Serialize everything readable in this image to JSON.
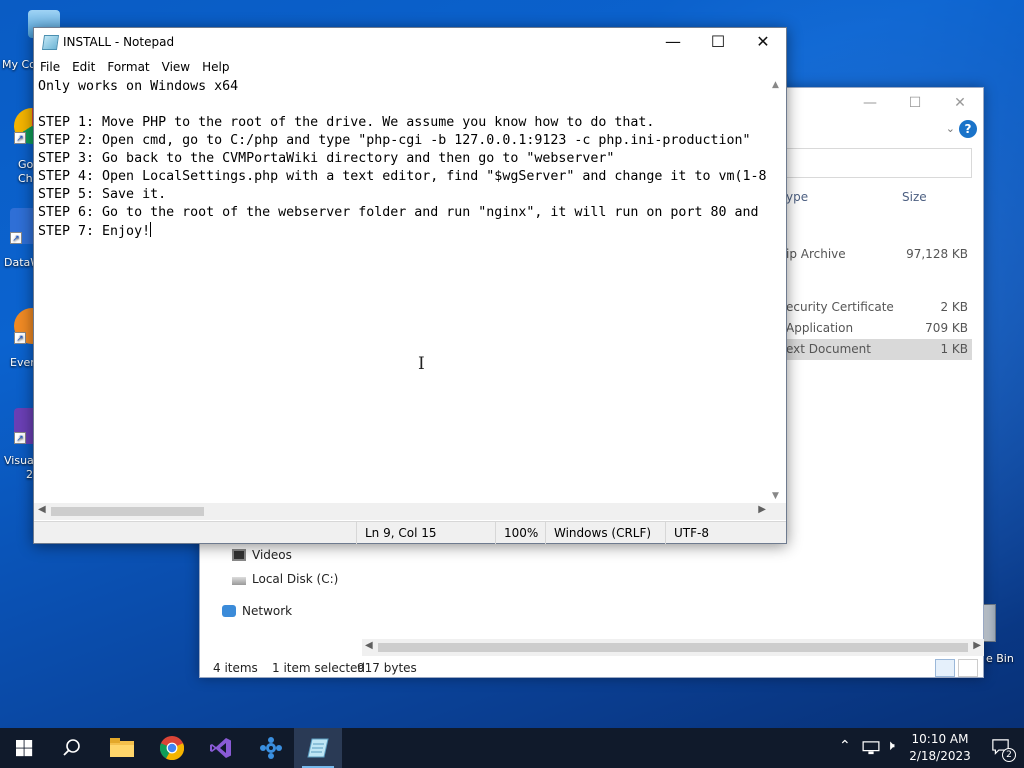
{
  "desktop": {
    "icons": [
      {
        "label": "My Co"
      },
      {
        "label": "Go"
      },
      {
        "label": "Ch"
      },
      {
        "label": "DataW"
      },
      {
        "label": "Ever"
      },
      {
        "label": "Visua"
      },
      {
        "label": "2"
      }
    ],
    "recycle_bin_label": "e Bin"
  },
  "explorer": {
    "columns": {
      "type": "ype",
      "size": "Size"
    },
    "files": [
      {
        "type": "ip Archive",
        "size": "97,128 KB"
      },
      {
        "type": "ecurity Certificate",
        "size": "2 KB"
      },
      {
        "type": "Application",
        "size": "709 KB"
      },
      {
        "type": "ext Document",
        "size": "1 KB"
      }
    ],
    "nav": [
      {
        "label": "Videos"
      },
      {
        "label": "Local Disk (C:)"
      },
      {
        "label": "Network"
      }
    ],
    "status": {
      "items": "4 items",
      "selected": "1 item selected",
      "size": "917 bytes"
    }
  },
  "notepad": {
    "title": "INSTALL - Notepad",
    "menu": [
      "File",
      "Edit",
      "Format",
      "View",
      "Help"
    ],
    "lines": [
      "Only works on Windows x64",
      "",
      "STEP 1: Move PHP to the root of the drive. We assume you know how to do that.",
      "STEP 2: Open cmd, go to C:/php and type \"php-cgi -b 127.0.0.1:9123 -c php.ini-production\"",
      "STEP 3: Go back to the CVMPortaWiki directory and then go to \"webserver\"",
      "STEP 4: Open LocalSettings.php with a text editor, find \"$wgServer\" and change it to vm(1-8",
      "STEP 5: Save it.",
      "STEP 6: Go to the root of the webserver folder and run \"nginx\", it will run on port 80 and",
      "STEP 7: Enjoy!"
    ],
    "status": {
      "position": "Ln 9, Col 15",
      "zoom": "100%",
      "line_endings": "Windows (CRLF)",
      "encoding": "UTF-8"
    }
  },
  "taskbar": {
    "apps": [
      "start",
      "search",
      "file-explorer",
      "chrome",
      "visual-studio",
      "app",
      "notepad"
    ],
    "clock": {
      "time": "10:10 AM",
      "date": "2/18/2023"
    },
    "notifications": "2"
  },
  "colors": {
    "accent": "#0a5cc4",
    "taskbar": "#101a2b",
    "selection": "#d9d9d9"
  }
}
